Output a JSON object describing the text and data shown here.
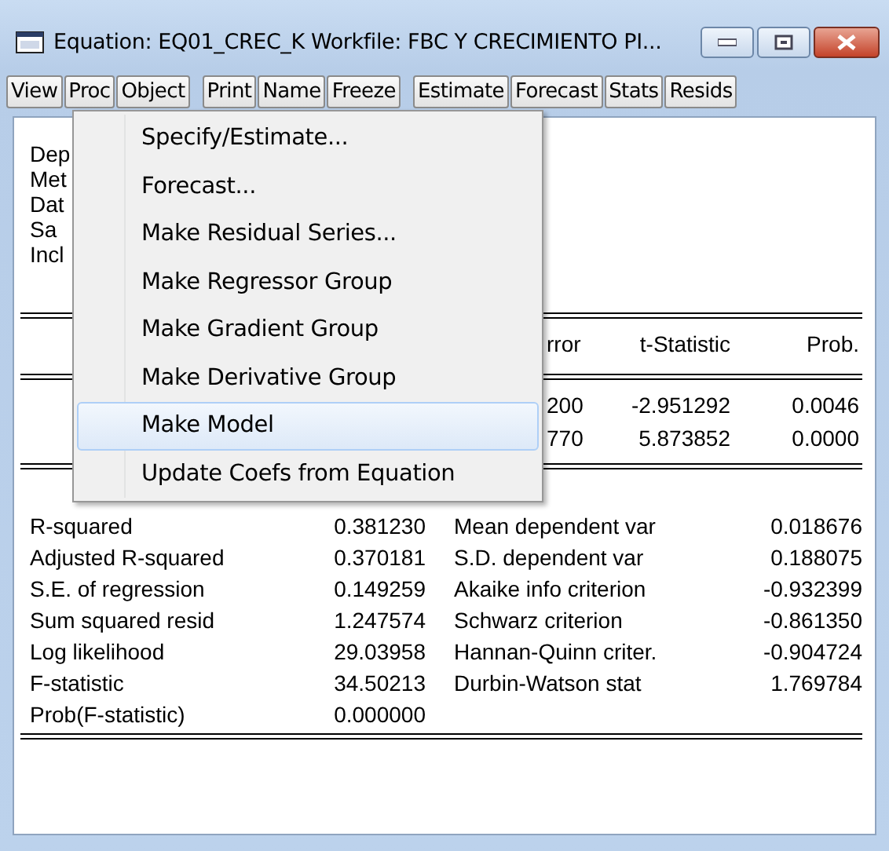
{
  "window": {
    "title": "Equation: EQ01_CREC_K   Workfile: FBC Y CRECIMIENTO PI..."
  },
  "toolbar": [
    [
      "View",
      "Proc",
      "Object"
    ],
    [
      "Print",
      "Name",
      "Freeze"
    ],
    [
      "Estimate",
      "Forecast",
      "Stats",
      "Resids"
    ]
  ],
  "header_lines": [
    "Dep",
    "Met",
    "Dat",
    "Sa",
    "Incl"
  ],
  "coef_table": {
    "columns": [
      "rror",
      "t-Statistic",
      "Prob."
    ],
    "rows": [
      [
        "200",
        "-2.951292",
        "0.0046"
      ],
      [
        "770",
        "5.873852",
        "0.0000"
      ]
    ]
  },
  "stats": [
    {
      "label": "R-squared",
      "value": "0.381230",
      "label_2": "Mean dependent var",
      "value_2": "0.018676"
    },
    {
      "label": "Adjusted R-squared",
      "value": "0.370181",
      "label_2": "S.D. dependent var",
      "value_2": "0.188075"
    },
    {
      "label": "S.E. of regression",
      "value": "0.149259",
      "label_2": "Akaike info criterion",
      "value_2": "-0.932399"
    },
    {
      "label": "Sum squared resid",
      "value": "1.247574",
      "label_2": "Schwarz criterion",
      "value_2": "-0.861350"
    },
    {
      "label": "Log likelihood",
      "value": "29.03958",
      "label_2": "Hannan-Quinn criter.",
      "value_2": "-0.904724"
    },
    {
      "label": "F-statistic",
      "value": "34.50213",
      "label_2": "Durbin-Watson stat",
      "value_2": "1.769784"
    },
    {
      "label": "Prob(F-statistic)",
      "value": "0.000000"
    }
  ],
  "menu": {
    "items": [
      {
        "label": "Specify/Estimate...",
        "selected": false
      },
      {
        "label": "Forecast...",
        "selected": false
      },
      {
        "label": "Make Residual Series...",
        "selected": false
      },
      {
        "label": "Make Regressor Group",
        "selected": false
      },
      {
        "label": "Make Gradient Group",
        "selected": false
      },
      {
        "label": "Make Derivative Group",
        "selected": false
      },
      {
        "label": "Make Model",
        "selected": true
      },
      {
        "label": "Update Coefs from Equation",
        "selected": false
      }
    ]
  }
}
